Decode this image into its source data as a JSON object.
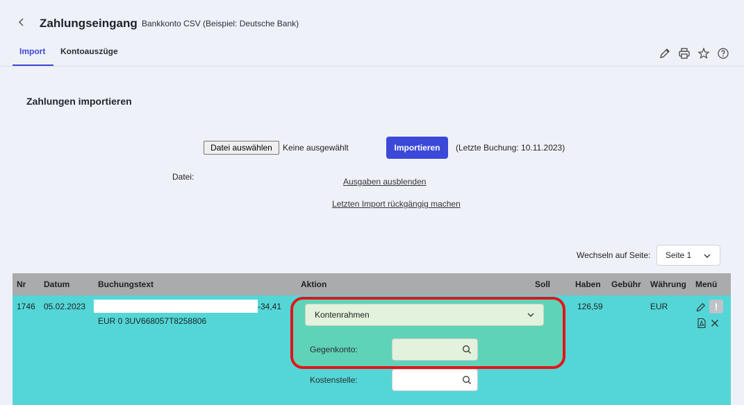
{
  "header": {
    "title": "Zahlungseingang",
    "subtitle": "Bankkonto CSV (Beispiel: Deutsche Bank)",
    "tabs": [
      {
        "label": "Import"
      },
      {
        "label": "Kontoauszüge"
      }
    ],
    "icons": [
      "pencil-icon",
      "print-icon",
      "star-icon",
      "help-icon"
    ]
  },
  "import": {
    "section_title": "Zahlungen importieren",
    "file_button": "Datei auswählen",
    "file_status": "Keine ausgewählt",
    "import_button": "Importieren",
    "last_booking": "(Letzte Buchung: 10.11.2023)",
    "file_label": "Datei:",
    "hide_output_link": "Ausgaben ausblenden",
    "undo_link": "Letzten Import rückgängig machen"
  },
  "pagination": {
    "label": "Wechseln auf Seite:",
    "selected": "Seite 1"
  },
  "table": {
    "columns": [
      "Nr",
      "Datum",
      "Buchungstext",
      "Aktion",
      "Soll",
      "Haben",
      "Gebühr",
      "Währung",
      "Menü"
    ],
    "rows": [
      {
        "nr": "1746",
        "datum": "05.02.2023",
        "amount_text": "-34,41",
        "buchungstext_line2": "EUR 0 3UV668057T8258806",
        "aktion_select": "Kontenrahmen",
        "gegenkonto_label": "Gegenkonto:",
        "kostenstelle_label": "Kostenstelle:",
        "soll": "",
        "haben": "126,59",
        "gebuehr": "",
        "waehrung": "EUR"
      }
    ]
  },
  "colors": {
    "accent": "#3b48d8",
    "row_highlight": "#54d6d6",
    "frame": "#e3141b"
  }
}
